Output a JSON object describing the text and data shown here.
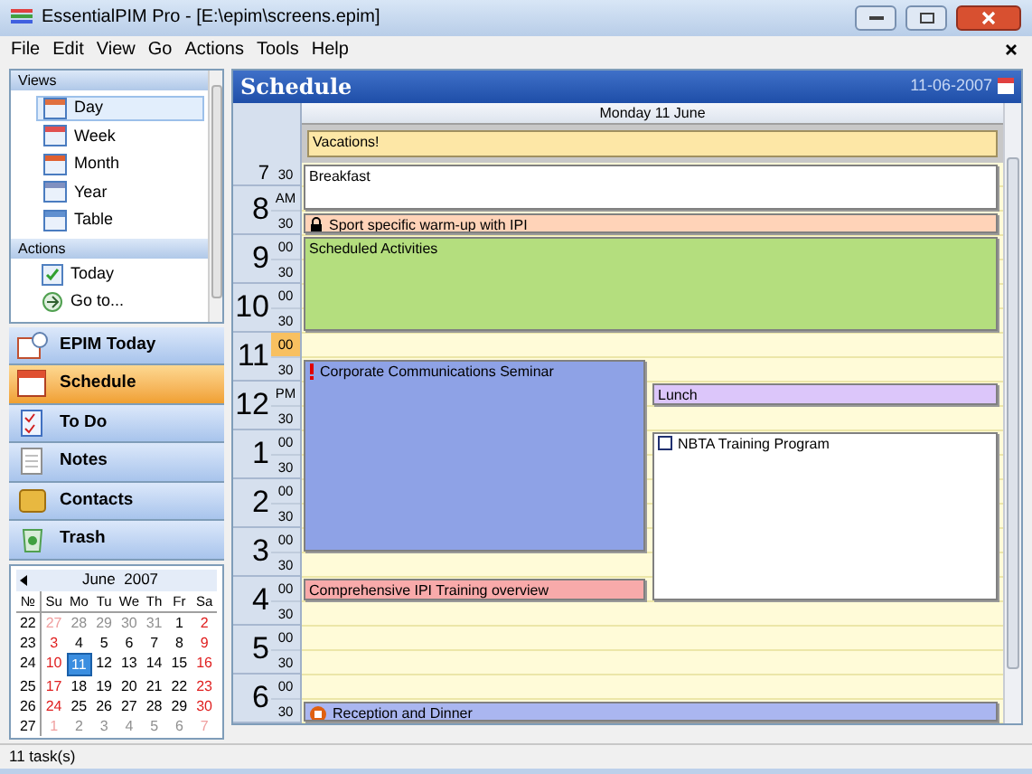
{
  "window": {
    "title": "EssentialPIM Pro - [E:\\epim\\screens.epim]"
  },
  "menu": [
    "File",
    "Edit",
    "View",
    "Go",
    "Actions",
    "Tools",
    "Help"
  ],
  "views": {
    "title": "Views",
    "items": [
      {
        "label": "Day",
        "selected": true
      },
      {
        "label": "Week",
        "selected": false
      },
      {
        "label": "Month",
        "selected": false
      },
      {
        "label": "Year",
        "selected": false
      },
      {
        "label": "Table",
        "selected": false
      }
    ]
  },
  "actions": {
    "title": "Actions",
    "items": [
      "Today",
      "Go to..."
    ]
  },
  "nav": [
    {
      "label": "EPIM Today",
      "selected": false
    },
    {
      "label": "Schedule",
      "selected": true
    },
    {
      "label": "To Do",
      "selected": false
    },
    {
      "label": "Notes",
      "selected": false
    },
    {
      "label": "Contacts",
      "selected": false
    },
    {
      "label": "Trash",
      "selected": false
    }
  ],
  "calendar": {
    "month": "June  2007",
    "headers": [
      "№",
      "Su",
      "Mo",
      "Tu",
      "We",
      "Th",
      "Fr",
      "Sa"
    ],
    "weeks": [
      {
        "week": "22",
        "days": [
          {
            "d": "27",
            "other": true,
            "selected": false
          },
          {
            "d": "28",
            "other": true,
            "selected": false
          },
          {
            "d": "29",
            "other": true,
            "selected": false
          },
          {
            "d": "30",
            "other": true,
            "selected": false
          },
          {
            "d": "31",
            "other": true,
            "selected": false
          },
          {
            "d": "1",
            "other": false,
            "selected": false
          },
          {
            "d": "2",
            "other": false,
            "selected": false
          }
        ]
      },
      {
        "week": "23",
        "days": [
          {
            "d": "3",
            "other": false,
            "selected": false
          },
          {
            "d": "4",
            "other": false,
            "selected": false
          },
          {
            "d": "5",
            "other": false,
            "selected": false
          },
          {
            "d": "6",
            "other": false,
            "selected": false
          },
          {
            "d": "7",
            "other": false,
            "selected": false
          },
          {
            "d": "8",
            "other": false,
            "selected": false
          },
          {
            "d": "9",
            "other": false,
            "selected": false
          }
        ]
      },
      {
        "week": "24",
        "days": [
          {
            "d": "10",
            "other": false,
            "selected": false
          },
          {
            "d": "11",
            "other": false,
            "selected": true
          },
          {
            "d": "12",
            "other": false,
            "selected": false
          },
          {
            "d": "13",
            "other": false,
            "selected": false
          },
          {
            "d": "14",
            "other": false,
            "selected": false
          },
          {
            "d": "15",
            "other": false,
            "selected": false
          },
          {
            "d": "16",
            "other": false,
            "selected": false
          }
        ]
      },
      {
        "week": "25",
        "days": [
          {
            "d": "17",
            "other": false,
            "selected": false
          },
          {
            "d": "18",
            "other": false,
            "selected": false
          },
          {
            "d": "19",
            "other": false,
            "selected": false
          },
          {
            "d": "20",
            "other": false,
            "selected": false
          },
          {
            "d": "21",
            "other": false,
            "selected": false
          },
          {
            "d": "22",
            "other": false,
            "selected": false
          },
          {
            "d": "23",
            "other": false,
            "selected": false
          }
        ]
      },
      {
        "week": "26",
        "days": [
          {
            "d": "24",
            "other": false,
            "selected": false
          },
          {
            "d": "25",
            "other": false,
            "selected": false
          },
          {
            "d": "26",
            "other": false,
            "selected": false
          },
          {
            "d": "27",
            "other": false,
            "selected": false
          },
          {
            "d": "28",
            "other": false,
            "selected": false
          },
          {
            "d": "29",
            "other": false,
            "selected": false
          },
          {
            "d": "30",
            "other": false,
            "selected": false
          }
        ]
      },
      {
        "week": "27",
        "days": [
          {
            "d": "1",
            "other": true,
            "selected": false
          },
          {
            "d": "2",
            "other": true,
            "selected": false
          },
          {
            "d": "3",
            "other": true,
            "selected": false
          },
          {
            "d": "4",
            "other": true,
            "selected": false
          },
          {
            "d": "5",
            "other": true,
            "selected": false
          },
          {
            "d": "6",
            "other": true,
            "selected": false
          },
          {
            "d": "7",
            "other": true,
            "selected": false
          }
        ]
      }
    ]
  },
  "schedule": {
    "title": "Schedule",
    "date": "11-06-2007",
    "day": "Monday 11 June",
    "all_day": [
      {
        "title": "Vacations!",
        "color": "#fde7a6"
      }
    ],
    "hours": [
      {
        "hour": "7",
        "labels": [
          "30"
        ],
        "current": false
      },
      {
        "hour": "8",
        "labels": [
          "AM",
          "30"
        ],
        "current": false
      },
      {
        "hour": "9",
        "labels": [
          "00",
          "30"
        ],
        "current": false
      },
      {
        "hour": "10",
        "labels": [
          "00",
          "30"
        ],
        "current": false
      },
      {
        "hour": "11",
        "labels": [
          "00",
          "30"
        ],
        "current": true
      },
      {
        "hour": "12",
        "labels": [
          "PM",
          "30"
        ],
        "current": false
      },
      {
        "hour": "1",
        "labels": [
          "00",
          "30"
        ],
        "current": false
      },
      {
        "hour": "2",
        "labels": [
          "00",
          "30"
        ],
        "current": false
      },
      {
        "hour": "3",
        "labels": [
          "00",
          "30"
        ],
        "current": false
      },
      {
        "hour": "4",
        "labels": [
          "00",
          "30"
        ],
        "current": false
      },
      {
        "hour": "5",
        "labels": [
          "00",
          "30"
        ],
        "current": false
      },
      {
        "hour": "6",
        "labels": [
          "00",
          "30"
        ],
        "current": false
      }
    ],
    "events": [
      {
        "title": "Breakfast",
        "kind": "plain",
        "color": "#ffffff"
      },
      {
        "title": "Sport specific warm-up with IPI",
        "kind": "locked",
        "color": "#ffd3b8"
      },
      {
        "title": "Scheduled Activities",
        "kind": "plain",
        "color": "#b4de7e"
      },
      {
        "title": "Corporate Communications Seminar",
        "kind": "important",
        "color": "#8ea2e6"
      },
      {
        "title": "Lunch",
        "kind": "plain",
        "color": "#dcc6fa"
      },
      {
        "title": "NBTA Training Program",
        "kind": "task",
        "color": "#ffffff"
      },
      {
        "title": "Comprehensive IPI Training overview",
        "kind": "plain",
        "color": "#f8aaaa"
      },
      {
        "title": "Reception and Dinner",
        "kind": "reminder",
        "color": "#aab6f0"
      }
    ]
  },
  "status_bar": "11 task(s)"
}
